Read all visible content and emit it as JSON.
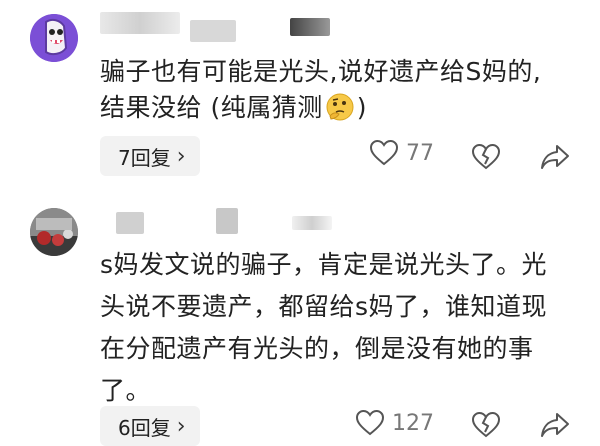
{
  "comments": [
    {
      "lines": [
        "骗子也有可能是光头,说好遗产给S妈的,",
        "结果没给 (纯属猜测"
      ],
      "emoji": "thinking-face-emoji",
      "close_paren": ")",
      "reply_label": "7回复",
      "likes": "77"
    },
    {
      "lines": [
        "s妈发文说的骗子，肯定是说光头了。光",
        "头说不要遗产，都留给s妈了，谁知道现",
        "在分配遗产有光头的，倒是没有她的事",
        "了。"
      ],
      "reply_label": "6回复",
      "likes": "127"
    }
  ],
  "icons": {
    "reply_chevron": "›",
    "like": "heart-icon",
    "dislike": "broken-heart-icon",
    "share": "share-arrow-icon"
  },
  "colors": {
    "text": "#222222",
    "meta": "#777777",
    "reply_bg": "#f2f2f2",
    "avatar1": "#7b4fd6"
  }
}
